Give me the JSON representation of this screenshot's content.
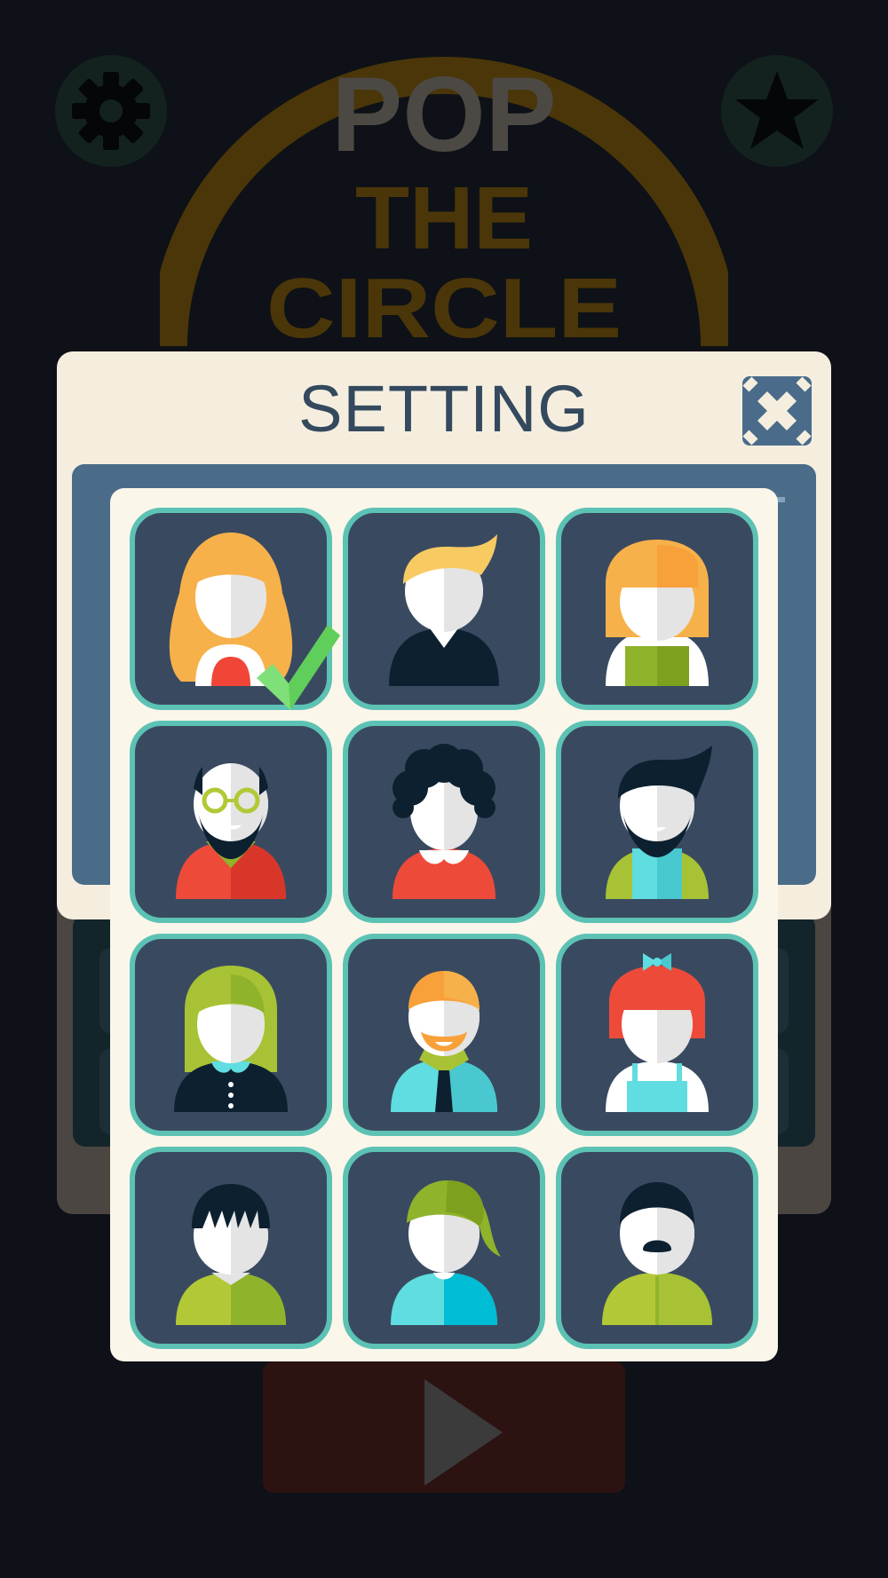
{
  "game": {
    "logo_lines": [
      "POP",
      "THE",
      "CIRCLE"
    ]
  },
  "dialog": {
    "title": "SETTING"
  },
  "avatars": {
    "selected": "avatar-1",
    "items": [
      "avatar-1",
      "avatar-2",
      "avatar-3",
      "avatar-4",
      "avatar-5",
      "avatar-6",
      "avatar-7",
      "avatar-8",
      "avatar-9",
      "avatar-10",
      "avatar-11",
      "avatar-12"
    ]
  },
  "icons": {
    "settings": "gear-icon",
    "favorites": "star-icon",
    "close": "close-icon",
    "play": "play-icon",
    "selected": "checkmark-icon"
  },
  "colors": {
    "accent_teal": "#5cc2b4",
    "tile_bg": "#394a60",
    "check_green": "#7fe07a",
    "title_text": "#34495e"
  }
}
